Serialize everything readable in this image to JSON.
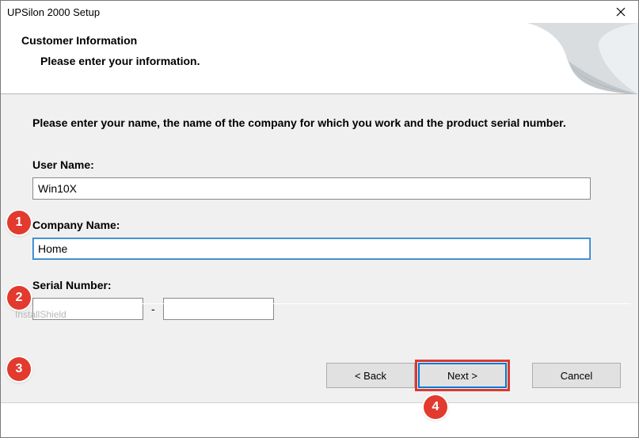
{
  "window": {
    "title": "UPSilon 2000 Setup"
  },
  "header": {
    "title": "Customer Information",
    "subtitle": "Please enter your information."
  },
  "content": {
    "instruction": "Please enter your name, the name of the company for which you work and the product serial number.",
    "user_name_label": "User Name:",
    "user_name_value": "Win10X",
    "company_label": "Company Name:",
    "company_value": "Home",
    "serial_label": "Serial Number:",
    "serial_part1": "",
    "serial_part2": "",
    "serial_dash": "-"
  },
  "footer": {
    "brand": "InstallShield",
    "back_label": "Back",
    "next_label": "Next",
    "cancel_label": "Cancel",
    "chev_left": "<",
    "chev_right": ">"
  },
  "annotations": {
    "b1": "1",
    "b2": "2",
    "b3": "3",
    "b4": "4"
  }
}
